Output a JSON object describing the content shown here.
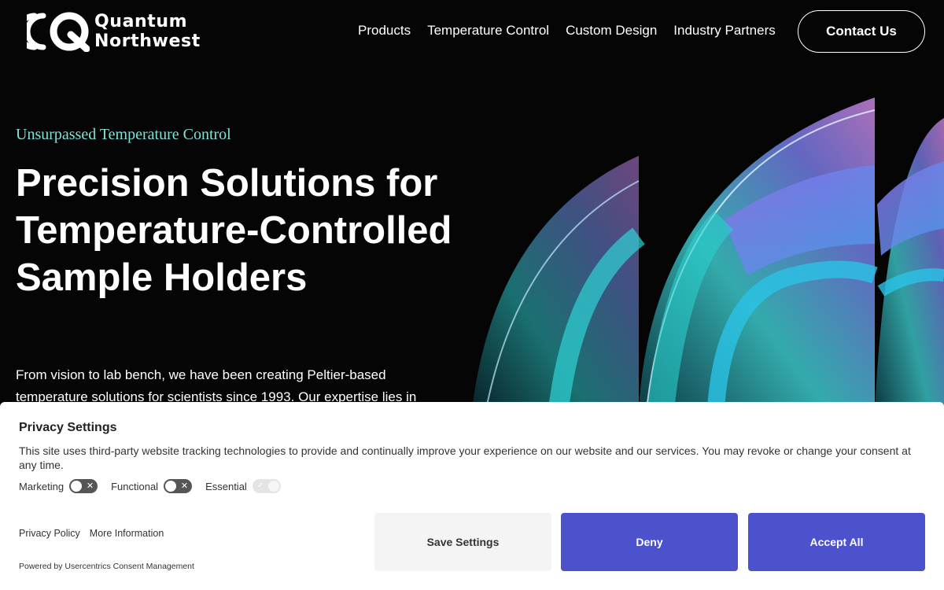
{
  "header": {
    "logo_lines": [
      "Quantum",
      "Northwest"
    ],
    "nav": [
      "Products",
      "Temperature Control",
      "Custom Design",
      "Industry Partners"
    ],
    "contact_label": "Contact Us"
  },
  "hero": {
    "eyebrow": "Unsurpassed Temperature Control",
    "title": "Precision Solutions for Temperature-Controlled Sample Holders",
    "body": "From vision to lab bench, we have been creating Peltier-based temperature solutions for scientists since 1993. Our expertise lies in"
  },
  "privacy": {
    "title": "Privacy Settings",
    "description": "This site uses third-party website tracking technologies to provide and continually improve your experience on our website and our services. You may revoke or change your consent at any time.",
    "toggles": [
      {
        "label": "Marketing",
        "on": false
      },
      {
        "label": "Functional",
        "on": false
      },
      {
        "label": "Essential",
        "on": true,
        "disabled": true
      }
    ],
    "links": [
      "Privacy Policy",
      "More Information"
    ],
    "powered": "Powered by Usercentrics Consent Management",
    "buttons": {
      "save": "Save Settings",
      "deny": "Deny",
      "accept": "Accept All"
    }
  },
  "colors": {
    "background": "#050505",
    "eyebrow": "#7ee3d9",
    "button_primary": "#4c52cc",
    "button_secondary": "#f4f4f4"
  },
  "icons": [
    "quantum-northwest-logo-icon",
    "close-icon",
    "check-icon"
  ]
}
